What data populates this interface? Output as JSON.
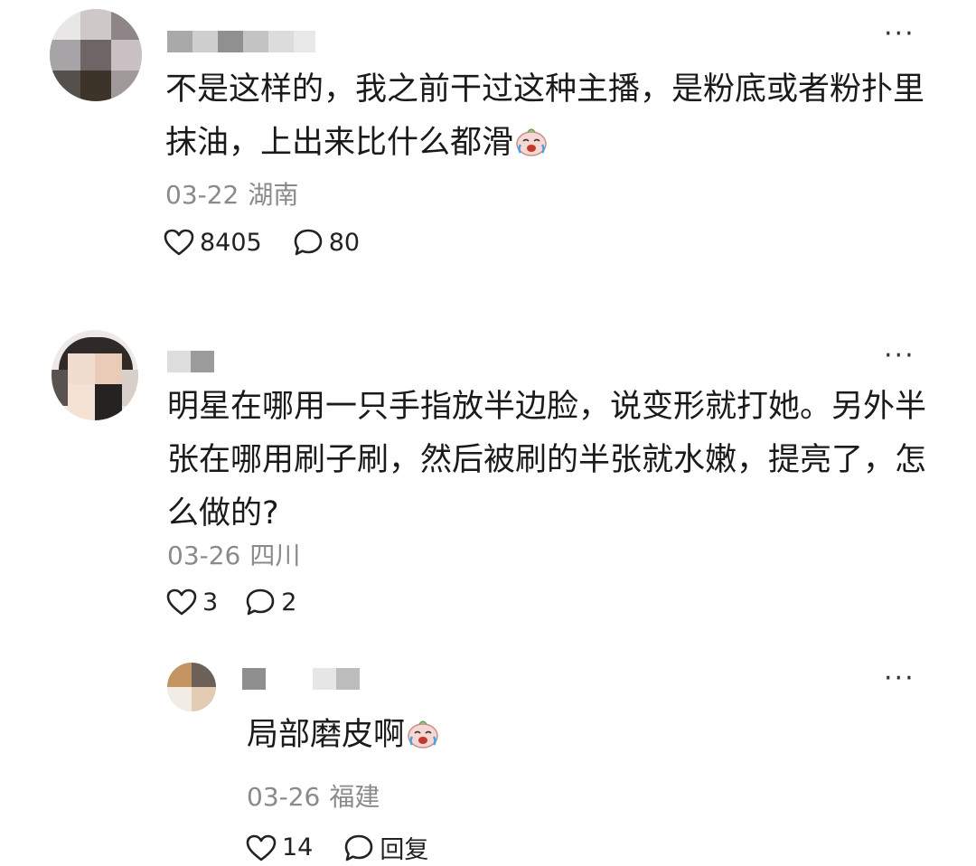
{
  "comments": [
    {
      "text_line1": "不是这样的，我之前干过这种主播，是粉底或者粉扑里",
      "text_line2": "抹油，上出来比什么都滑",
      "date": "03-22",
      "location": "湖南",
      "likes": "8405",
      "replies": "80",
      "emoji": "crying-laughing-emoji"
    },
    {
      "text_line1": "明星在哪用一只手指放半边脸，说变形就打她。另外半",
      "text_line2": "张在哪用刷子刷，然后被刷的半张就水嫩，提亮了，怎",
      "text_line3": "么做的?",
      "date": "03-26",
      "location": "四川",
      "likes": "3",
      "replies": "2"
    },
    {
      "text_line1": "局部磨皮啊",
      "date": "03-26",
      "location": "福建",
      "likes": "14",
      "reply_label": "回复",
      "emoji": "crying-laughing-emoji"
    }
  ],
  "more_label": "···",
  "icons": {
    "like": "heart-outline-icon",
    "reply": "speech-bubble-icon",
    "more": "more-dots-icon"
  }
}
